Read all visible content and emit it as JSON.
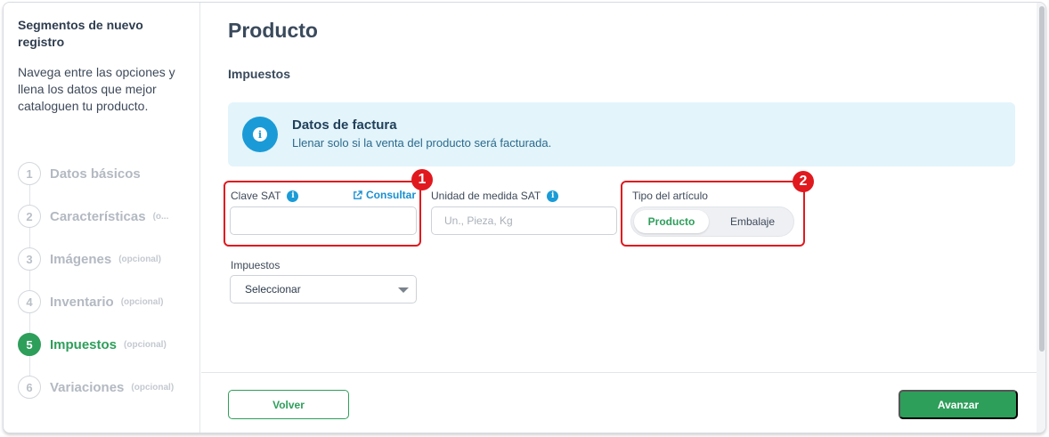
{
  "sidebar": {
    "title": "Segmentos de nuevo registro",
    "description": "Navega entre las opciones y llena los datos que mejor cataloguen tu producto.",
    "steps": [
      {
        "number": "1",
        "label": "Datos básicos",
        "optional": ""
      },
      {
        "number": "2",
        "label": "Características",
        "optional": "(o..."
      },
      {
        "number": "3",
        "label": "Imágenes",
        "optional": "(opcional)"
      },
      {
        "number": "4",
        "label": "Inventario",
        "optional": "(opcional)"
      },
      {
        "number": "5",
        "label": "Impuestos",
        "optional": "(opcional)"
      },
      {
        "number": "6",
        "label": "Variaciones",
        "optional": "(opcional)"
      }
    ],
    "active_step": "5"
  },
  "main": {
    "title": "Producto",
    "section": "Impuestos",
    "info": {
      "icon": "info-icon",
      "title": "Datos de factura",
      "subtitle": "Llenar solo si la venta del producto será facturada."
    },
    "clave_sat": {
      "label": "Clave SAT",
      "value": "",
      "link": "Consultar"
    },
    "unidad_medida": {
      "label": "Unidad de medida SAT",
      "value": "",
      "placeholder": "Un., Pieza, Kg"
    },
    "tipo_articulo": {
      "label": "Tipo del artículo",
      "options": [
        "Producto",
        "Embalaje"
      ],
      "selected": "Producto"
    },
    "impuestos": {
      "label": "Impuestos",
      "selected": "Seleccionar"
    },
    "annotations": [
      "1",
      "2"
    ]
  },
  "footer": {
    "back_label": "Volver",
    "next_label": "Avanzar"
  },
  "colors": {
    "accent": "#2e9e5b",
    "info": "#1a9bd7",
    "highlight": "#e0191f",
    "info_bg": "#e3f4fb"
  }
}
